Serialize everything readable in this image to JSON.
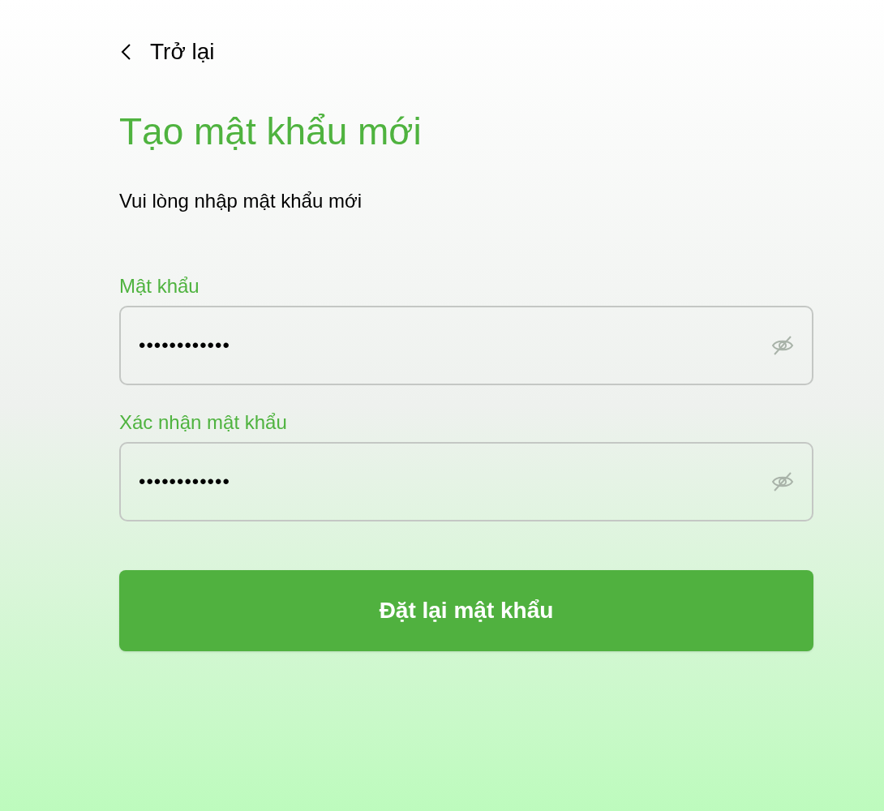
{
  "back": {
    "label": "Trở lại"
  },
  "title": "Tạo mật khẩu mới",
  "subtitle": "Vui lòng nhập mật khẩu mới",
  "fields": [
    {
      "label": "Mật khẩu",
      "value": "••••••••••••"
    },
    {
      "label": "Xác nhận mật khẩu",
      "value": "••••••••••••"
    }
  ],
  "submit": {
    "label": "Đặt lại mật khẩu"
  }
}
